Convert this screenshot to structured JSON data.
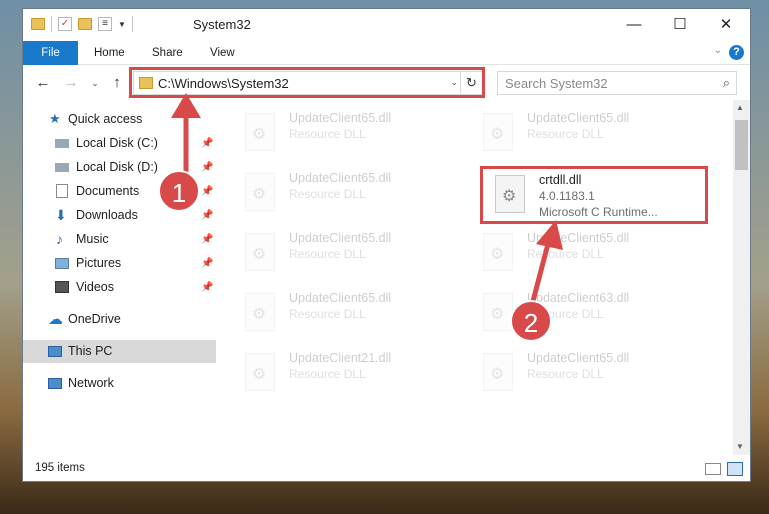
{
  "window": {
    "title": "System32",
    "controls": {
      "minimize": "—",
      "maximize": "☐",
      "close": "✕"
    }
  },
  "ribbon": {
    "tabs": [
      "File",
      "Home",
      "Share",
      "View"
    ],
    "help": "?"
  },
  "nav": {
    "address": "C:\\Windows\\System32",
    "search_placeholder": "Search System32"
  },
  "sidebar": {
    "quick_access": "Quick access",
    "items": [
      {
        "label": "Local Disk (C:)",
        "icon": "drive-icon",
        "pinned": true
      },
      {
        "label": "Local Disk (D:)",
        "icon": "drive-icon",
        "pinned": true
      },
      {
        "label": "Documents",
        "icon": "documents-icon",
        "pinned": true
      },
      {
        "label": "Downloads",
        "icon": "downloads-icon",
        "pinned": true
      },
      {
        "label": "Music",
        "icon": "music-icon",
        "pinned": true
      },
      {
        "label": "Pictures",
        "icon": "pictures-icon",
        "pinned": true
      },
      {
        "label": "Videos",
        "icon": "videos-icon",
        "pinned": true
      }
    ],
    "onedrive": "OneDrive",
    "this_pc": "This PC",
    "network": "Network"
  },
  "files": [
    {
      "name": "UpdateClient65.dll",
      "meta": "Resource DLL"
    },
    {
      "name": "UpdateClient65.dll",
      "meta": "Resource DLL"
    },
    {
      "name": "UpdateClient65.dll",
      "meta": "Resource DLL"
    },
    {
      "name": "crtdll.dll",
      "version": "4.0.1183.1",
      "description": "Microsoft C Runtime..."
    },
    {
      "name": "UpdateClient65.dll",
      "meta": "Resource DLL"
    },
    {
      "name": "UpdateClient65.dll",
      "meta": "Resource DLL"
    },
    {
      "name": "UpdateClient65.dll",
      "meta": "Resource DLL"
    },
    {
      "name": "UpdateClient63.dll",
      "meta": "Resource DLL"
    },
    {
      "name": "UpdateClient21.dll",
      "meta": "Resource DLL"
    },
    {
      "name": "UpdateClient65.dll",
      "meta": "Resource DLL"
    }
  ],
  "status": {
    "items_count": "195 items"
  },
  "annotations": {
    "step1": "1",
    "step2": "2",
    "color": "#d84a4a"
  }
}
